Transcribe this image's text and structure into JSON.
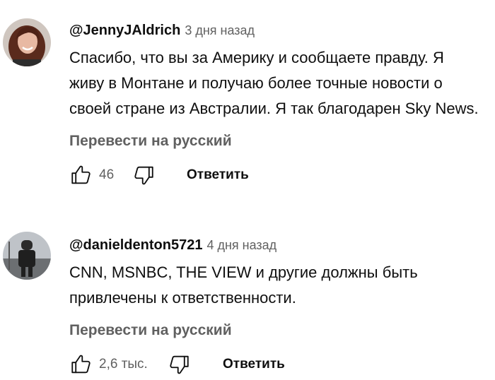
{
  "comments": [
    {
      "author": "@JennyJAldrich",
      "time": "3 дня назад",
      "text": "Спасибо, что вы за Америку и сообщаете правду. Я живу в Монтане и получаю более точные новости о своей стране из Австралии. Я так благодарен Sky News.",
      "translate_label": "Перевести на русский",
      "likes": "46",
      "reply_label": "Ответить"
    },
    {
      "author": "@danieldenton5721",
      "time": "4 дня назад",
      "text": "CNN, MSNBC, THE VIEW и другие должны быть привлечены к ответственности.",
      "translate_label": "Перевести на русский",
      "likes": "2,6 тыс.",
      "reply_label": "Ответить"
    }
  ],
  "icons": {
    "like": "thumbs-up-icon",
    "dislike": "thumbs-down-icon"
  }
}
